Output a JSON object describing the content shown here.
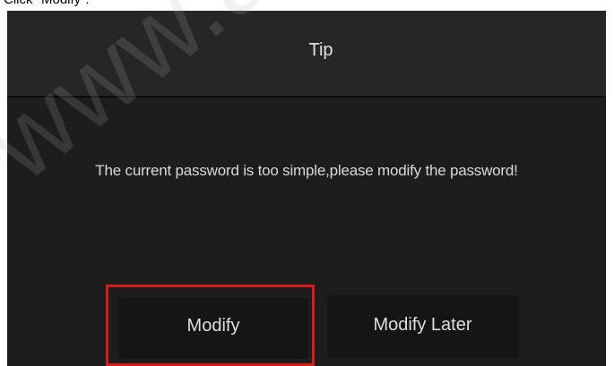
{
  "instruction": {
    "text": "Click \"Modify\"."
  },
  "dialog": {
    "title": "Tip",
    "message": "The current password is too simple,please modify the password!",
    "buttons": {
      "modify_label": "Modify",
      "modify_later_label": "Modify Later"
    }
  },
  "annotation": {
    "highlight_color": "#d51c1c",
    "highlighted": "modify-button"
  },
  "watermark": {
    "text": "www.atis-so"
  },
  "colors": {
    "dialog_background": "#1d1d1d",
    "header_background": "#262626",
    "button_background": "#151515",
    "text": "#dedede"
  }
}
